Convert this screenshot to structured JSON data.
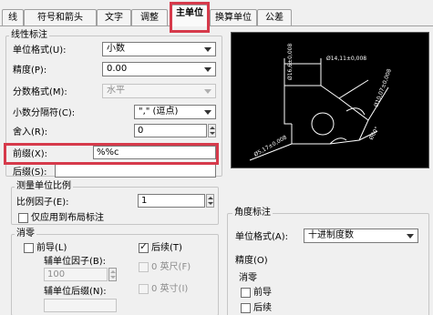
{
  "tabs": [
    {
      "label": "线"
    },
    {
      "label": "符号和箭头"
    },
    {
      "label": "文字"
    },
    {
      "label": "调整"
    },
    {
      "label": "主单位"
    },
    {
      "label": "换算单位"
    },
    {
      "label": "公差"
    }
  ],
  "linear": {
    "title": "线性标注",
    "unit_format_label": "单位格式(U):",
    "unit_format_value": "小数",
    "precision_label": "精度(P):",
    "precision_value": "0.00",
    "fraction_label": "分数格式(M):",
    "fraction_value": "水平",
    "decimal_sep_label": "小数分隔符(C):",
    "decimal_sep_value": "\",\" (逗点)",
    "roundoff_label": "舍入(R):",
    "roundoff_value": "0",
    "prefix_label": "前缀(X):",
    "prefix_value": "%%c",
    "suffix_label": "后缀(S):",
    "suffix_value": ""
  },
  "measurement": {
    "title": "测量单位比例",
    "scale_label": "比例因子(E):",
    "scale_value": "1",
    "layout_only_label": "仅应用到布局标注"
  },
  "zero": {
    "title": "消零",
    "leading_label": "前导(L)",
    "trailing_label": "后续(T)",
    "sub_factor_label": "辅单位因子(B):",
    "sub_factor_value": "100",
    "sub_suffix_label": "辅单位后缀(N):",
    "feet_label": "0 英尺(F)",
    "inch_label": "0 英寸(I)"
  },
  "angular": {
    "title": "角度标注",
    "unit_format_label": "单位格式(A):",
    "unit_format_value": "十进制度数",
    "precision_label": "精度(O)",
    "zero_title": "消零",
    "leading_label": "前导",
    "trailing_label": "后续"
  },
  "preview": {
    "dim_top": "Ø14,11±0,008",
    "dim_left": "Ø16,6±0,008",
    "dim_right": "Ø10,07±0,008",
    "dim_bottom": "Ø5,17±0,008",
    "dim_angle": "Ø60°"
  },
  "colors": {
    "highlight": "#d63a4b",
    "preview_bg": "#000000",
    "preview_lines": "#ffffff"
  }
}
